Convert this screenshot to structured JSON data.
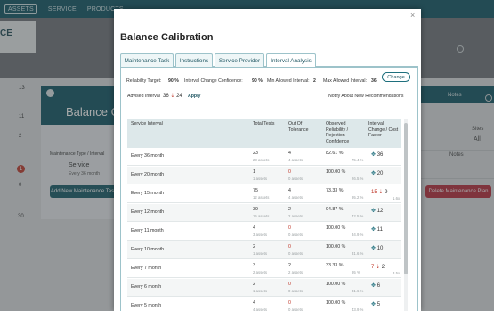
{
  "topnav": {
    "items": [
      "ASSETS",
      "SERVICE",
      "PRODUCTS"
    ]
  },
  "background": {
    "left_panel_text": "CE",
    "title": "Balance Calib",
    "table_label": "Maintenance Type / Interval",
    "service_name": "Service",
    "service_sub": "Every 36 month",
    "add_button": "Add New Maintenance Task",
    "delete_button": "Delete Maintenance Plan",
    "badge": "1",
    "side_numbers": [
      "13",
      "11",
      "2",
      "0",
      "30"
    ],
    "right_labels": [
      "Notes",
      "Sites",
      "All",
      "Notes"
    ]
  },
  "modal": {
    "title": "Balance Calibration",
    "close_icon": "×",
    "tabs": [
      "Maintenance Task",
      "Instructions",
      "Service Provider",
      "Interval Analysis"
    ],
    "active_tab": 3,
    "params": {
      "reliability_target_label": "Reliability Target:",
      "reliability_target_value": "90 %",
      "interval_change_label": "Interval Change Confidence:",
      "interval_change_value": "90 %",
      "min_interval_label": "Min Allowed Interval:",
      "min_interval_value": "2",
      "max_interval_label": "Max Allowed Interval:",
      "max_interval_value": "36"
    },
    "change_button": "Change",
    "advised": {
      "label": "Advised Interval",
      "from": "36",
      "to": "24",
      "apply": "Apply"
    },
    "notify_label": "Notify About New Recommendations",
    "table": {
      "headers": [
        "Service Interval",
        "Total Tests",
        "Out Of Tolerance",
        "Observed Reliability / Rejection Confidence",
        "Interval Change / Cost Factor"
      ],
      "rows": [
        {
          "interval": "Every 36 month",
          "tests": "23",
          "tests_sub": "23 assets",
          "oot": "4",
          "oot_sub": "4 assets",
          "reliability": "82.61 %",
          "confidence": "75.4 %",
          "change": "36",
          "change_to": "",
          "cost": "",
          "direction": "up"
        },
        {
          "interval": "Every 20 month",
          "tests": "1",
          "tests_sub": "1 assets",
          "oot": "0",
          "oot_sub": "0 assets",
          "reliability": "100.00 %",
          "confidence": "26.5 %",
          "change": "20",
          "change_to": "",
          "cost": "",
          "direction": "up"
        },
        {
          "interval": "Every 15 month",
          "tests": "75",
          "tests_sub": "12 assets",
          "oot": "4",
          "oot_sub": "4 assets",
          "reliability": "73.33 %",
          "confidence": "95.2 %",
          "change": "15",
          "change_to": "9",
          "cost": "1.6x",
          "direction": "down"
        },
        {
          "interval": "Every 12 month",
          "tests": "39",
          "tests_sub": "15 assets",
          "oot": "2",
          "oot_sub": "2 assets",
          "reliability": "94.87 %",
          "confidence": "42.5 %",
          "change": "12",
          "change_to": "",
          "cost": "",
          "direction": "up"
        },
        {
          "interval": "Every 11 month",
          "tests": "4",
          "tests_sub": "3 assets",
          "oot": "0",
          "oot_sub": "0 assets",
          "reliability": "100.00 %",
          "confidence": "34.9 %",
          "change": "11",
          "change_to": "",
          "cost": "",
          "direction": "up"
        },
        {
          "interval": "Every 10 month",
          "tests": "2",
          "tests_sub": "1 assets",
          "oot": "0",
          "oot_sub": "0 assets",
          "reliability": "100.00 %",
          "confidence": "31.6 %",
          "change": "10",
          "change_to": "",
          "cost": "",
          "direction": "up"
        },
        {
          "interval": "Every 7 month",
          "tests": "3",
          "tests_sub": "2 assets",
          "oot": "2",
          "oot_sub": "2 assets",
          "reliability": "33.33 %",
          "confidence": "95 %",
          "change": "7",
          "change_to": "2",
          "cost": "3.5x",
          "direction": "down"
        },
        {
          "interval": "Every 6 month",
          "tests": "2",
          "tests_sub": "1 assets",
          "oot": "0",
          "oot_sub": "0 assets",
          "reliability": "100.00 %",
          "confidence": "31.6 %",
          "change": "6",
          "change_to": "",
          "cost": "",
          "direction": "up"
        },
        {
          "interval": "Every 5 month",
          "tests": "4",
          "tests_sub": "4 assets",
          "oot": "0",
          "oot_sub": "0 assets",
          "reliability": "100.00 %",
          "confidence": "43.9 %",
          "change": "5",
          "change_to": "",
          "cost": "",
          "direction": "up"
        }
      ]
    }
  },
  "colors": {
    "brand": "#0f5563",
    "accent_red": "#c0392b"
  }
}
